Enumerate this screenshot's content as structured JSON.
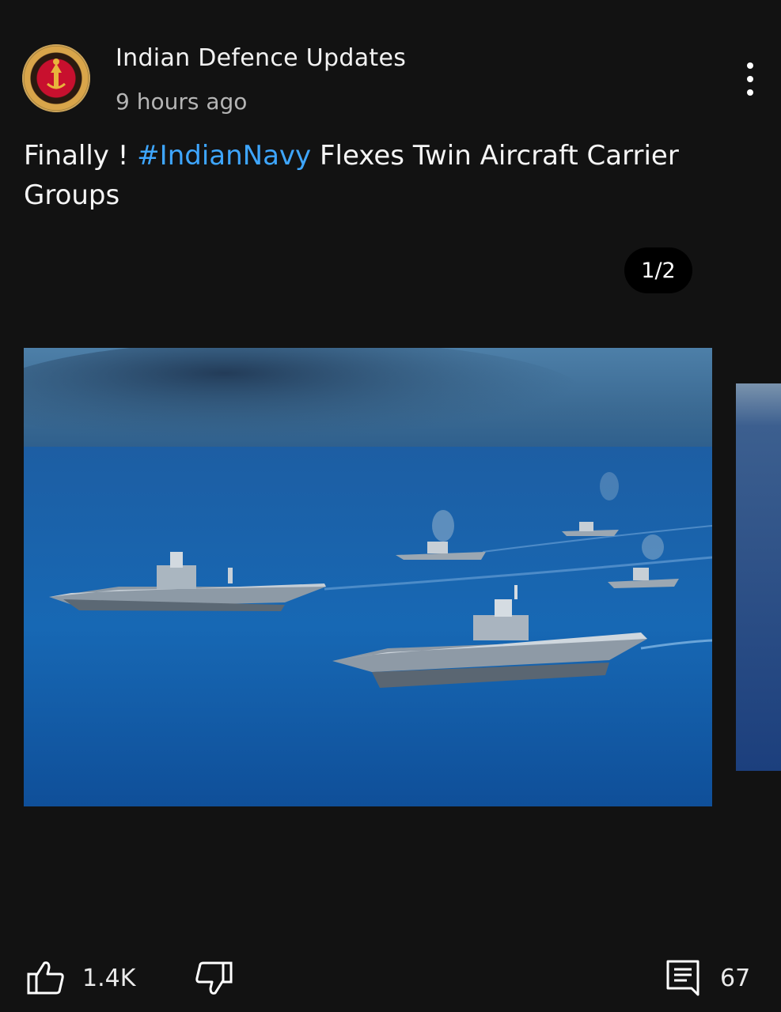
{
  "post": {
    "channel_name": "Indian Defence Updates",
    "timestamp": "9 hours ago",
    "text_prefix": "Finally ! ",
    "hashtag": "#IndianNavy",
    "text_suffix": " Flexes Twin Aircraft Carrier Groups",
    "image_counter": "1/2",
    "likes": "1.4K",
    "comments": "67"
  },
  "icons": {
    "avatar": "channel-logo",
    "menu": "more-vert-icon",
    "like": "thumbs-up-icon",
    "dislike": "thumbs-down-icon",
    "comments": "comment-icon"
  },
  "colors": {
    "background": "#121212",
    "hashtag": "#3ea6ff",
    "text": "#f5f5f5",
    "secondary_text": "#b5b5b5"
  }
}
